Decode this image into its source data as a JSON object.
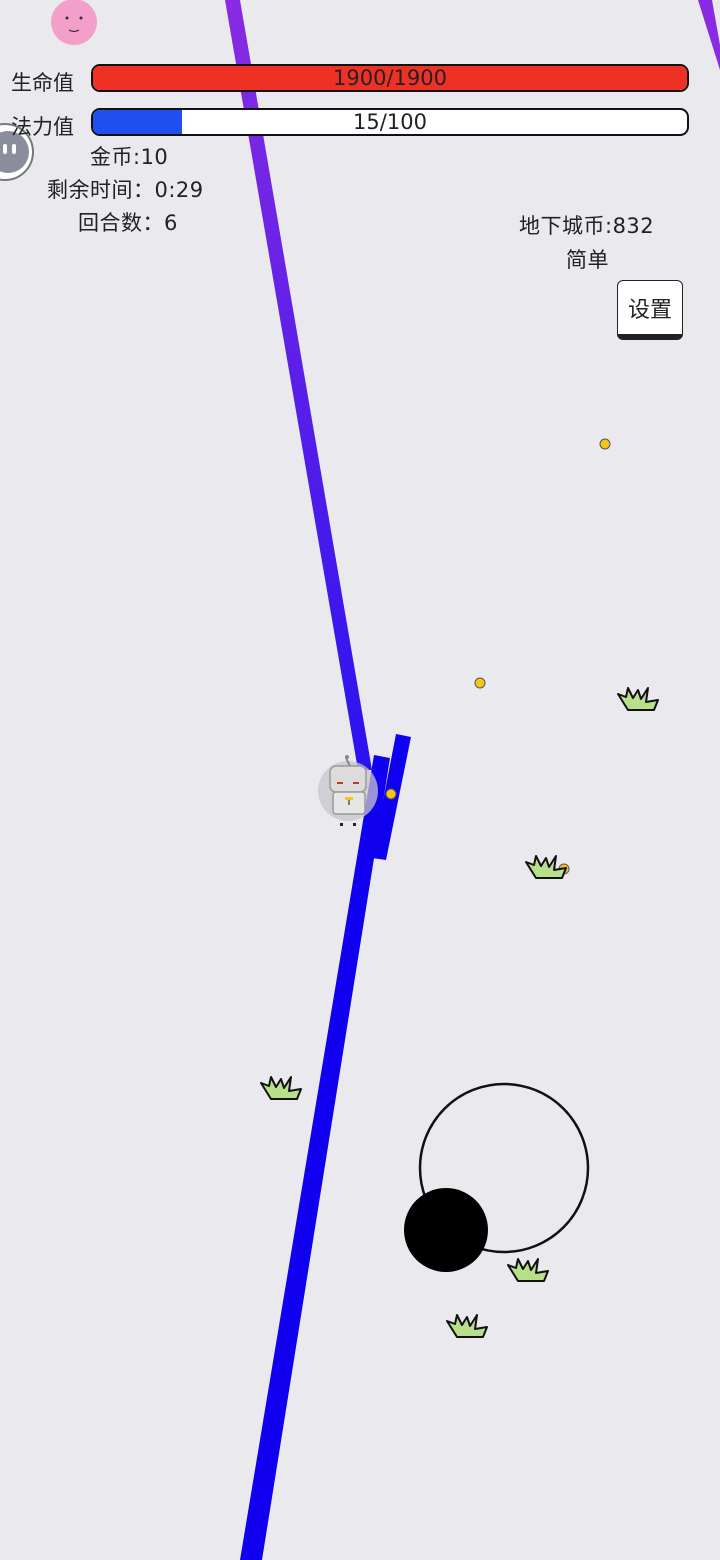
{
  "hud": {
    "hp_label": "生命值",
    "hp_text": "1900/1900",
    "hp_fraction": 1.0,
    "mp_label": "法力值",
    "mp_text": "15/100",
    "mp_fraction": 0.15,
    "gold": "金币:10",
    "time_left": "剩余时间：0:29",
    "round": "回合数：6",
    "dungeon_coins": "地下城币:832",
    "difficulty": "简单",
    "settings_label": "设置"
  },
  "colors": {
    "background": "#e9e9ee",
    "hp_bar": "#ee3124",
    "mp_bar": "#1f4ff0",
    "laser_purple": "#8a2be2",
    "laser_blue": "#1000f0",
    "coin": "#f5c518",
    "grass": "#b8e08a",
    "joystick_knob": "#000000"
  },
  "icons": {
    "player": "robot-character-icon",
    "top_enemy": "pink-face-icon",
    "left_enemy": "ghost-face-icon",
    "coin": "gold-coin-icon",
    "grass": "grass-tuft-icon"
  }
}
